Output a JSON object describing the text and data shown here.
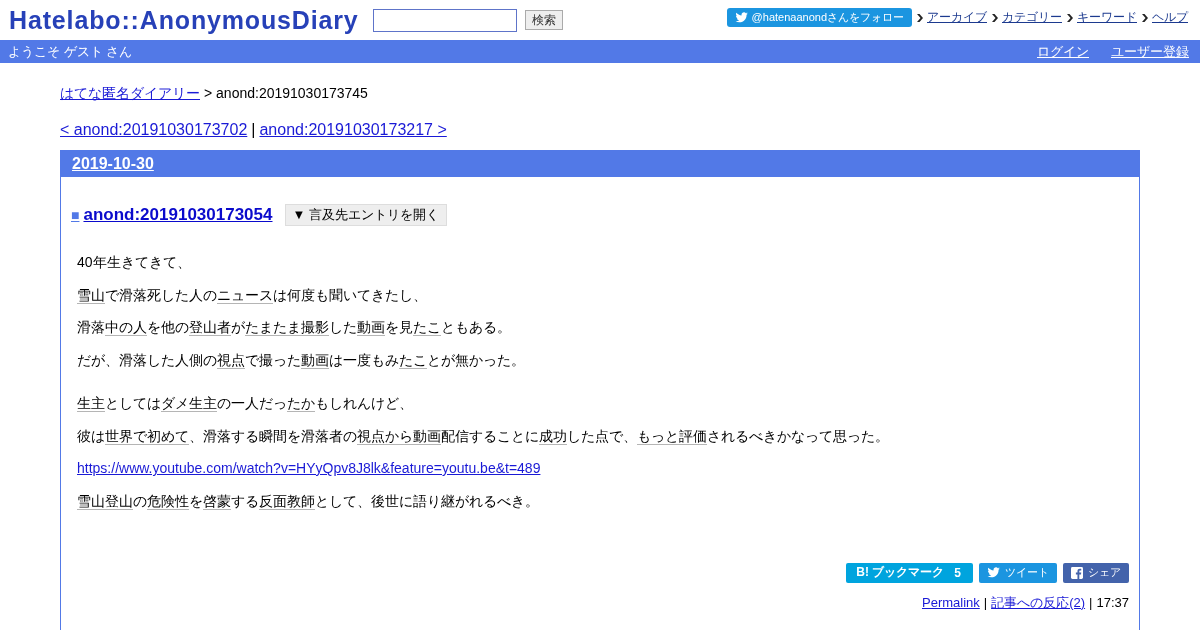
{
  "header": {
    "logo": "Hatelabo::AnonymousDiary",
    "search_button": "検索",
    "follow_button": "@hatenaanondさんをフォロー",
    "nav_links": [
      "アーカイブ",
      "カテゴリー",
      "キーワード",
      "ヘルプ"
    ]
  },
  "user_bar": {
    "greeting": "ようこそ ゲスト さん",
    "links": [
      "ログイン",
      "ユーザー登録"
    ]
  },
  "breadcrumb": {
    "link": "はてな匿名ダイアリー",
    "current": "> anond:20191030173745"
  },
  "pager": {
    "previous": "< anond:20191030173702",
    "separator": "|",
    "next": "anond:20191030173217 >"
  },
  "day": {
    "date": "2019-10-30",
    "entry": {
      "marker": "■",
      "title": "anond:20191030173054",
      "reference_button": "▼ 言及先エントリを開く",
      "body": [
        {
          "paragraphs": [
            {
              "kind": "text",
              "parts": [
                {
                  "kind": "plain",
                  "text": "40年生きてきて、"
                }
              ]
            },
            {
              "kind": "text",
              "parts": [
                {
                  "kind": "keyword",
                  "text": "雪山"
                },
                {
                  "kind": "plain",
                  "text": "で滑落死した人の"
                },
                {
                  "kind": "keyword",
                  "text": "ニュース"
                },
                {
                  "kind": "plain",
                  "text": "は何度も聞いてきたし、"
                }
              ]
            },
            {
              "kind": "text",
              "parts": [
                {
                  "kind": "plain",
                  "text": "滑落"
                },
                {
                  "kind": "keyword",
                  "text": "中の人"
                },
                {
                  "kind": "plain",
                  "text": "を他の"
                },
                {
                  "kind": "keyword",
                  "text": "登山者"
                },
                {
                  "kind": "plain",
                  "text": "が"
                },
                {
                  "kind": "keyword",
                  "text": "たまたま撮影"
                },
                {
                  "kind": "plain",
                  "text": "した"
                },
                {
                  "kind": "keyword",
                  "text": "動画"
                },
                {
                  "kind": "plain",
                  "text": "を見"
                },
                {
                  "kind": "keyword",
                  "text": "たこ"
                },
                {
                  "kind": "plain",
                  "text": "ともある。"
                }
              ]
            },
            {
              "kind": "text",
              "parts": [
                {
                  "kind": "plain",
                  "text": "だが、滑落した人側の"
                },
                {
                  "kind": "keyword",
                  "text": "視点"
                },
                {
                  "kind": "plain",
                  "text": "で撮った"
                },
                {
                  "kind": "keyword",
                  "text": "動画"
                },
                {
                  "kind": "plain",
                  "text": "は一度もみ"
                },
                {
                  "kind": "keyword",
                  "text": "たこ"
                },
                {
                  "kind": "plain",
                  "text": "とが無かった。"
                }
              ]
            }
          ]
        },
        {
          "paragraphs": [
            {
              "kind": "text",
              "parts": [
                {
                  "kind": "keyword",
                  "text": "生主"
                },
                {
                  "kind": "plain",
                  "text": "としては"
                },
                {
                  "kind": "keyword",
                  "text": "ダメ生主"
                },
                {
                  "kind": "plain",
                  "text": "の一人だっ"
                },
                {
                  "kind": "keyword",
                  "text": "たか"
                },
                {
                  "kind": "plain",
                  "text": "もしれんけど、"
                }
              ]
            },
            {
              "kind": "text",
              "parts": [
                {
                  "kind": "plain",
                  "text": "彼は"
                },
                {
                  "kind": "keyword",
                  "text": "世界で初めて"
                },
                {
                  "kind": "plain",
                  "text": "、滑落する瞬間を滑落者の"
                },
                {
                  "kind": "keyword",
                  "text": "視点から動画"
                },
                {
                  "kind": "plain",
                  "text": "配信することに"
                },
                {
                  "kind": "keyword",
                  "text": "成功"
                },
                {
                  "kind": "plain",
                  "text": "した点で、"
                },
                {
                  "kind": "keyword",
                  "text": "もっと評価"
                },
                {
                  "kind": "plain",
                  "text": "されるべきかなって思った。"
                }
              ]
            },
            {
              "kind": "url",
              "text": "https://www.youtube.com/watch?v=HYyQpv8J8lk&feature=youtu.be&t=489"
            },
            {
              "kind": "text",
              "parts": [
                {
                  "kind": "keyword",
                  "text": "雪山登山"
                },
                {
                  "kind": "plain",
                  "text": "の"
                },
                {
                  "kind": "keyword",
                  "text": "危険性"
                },
                {
                  "kind": "plain",
                  "text": "を"
                },
                {
                  "kind": "keyword",
                  "text": "啓蒙"
                },
                {
                  "kind": "plain",
                  "text": "する"
                },
                {
                  "kind": "keyword",
                  "text": "反面教師"
                },
                {
                  "kind": "plain",
                  "text": "として、後世に語り継がれるべき。"
                }
              ]
            }
          ]
        }
      ],
      "share_buttons": [
        {
          "kind": "bookmark",
          "label": "B! ブックマーク",
          "count": "5"
        },
        {
          "kind": "tweet",
          "label": "ツイート"
        },
        {
          "kind": "facebook",
          "label": "シェア"
        }
      ],
      "footer": [
        {
          "kind": "link",
          "text": "Permalink"
        },
        {
          "kind": "separator",
          "text": "|"
        },
        {
          "kind": "link",
          "text": "記事への反応(2)"
        },
        {
          "kind": "separator",
          "text": "|"
        },
        {
          "kind": "time",
          "text": "17:37"
        }
      ]
    }
  }
}
